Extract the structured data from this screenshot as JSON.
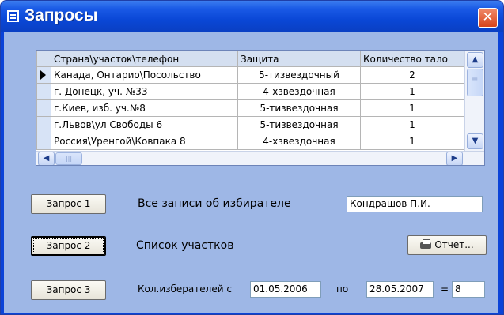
{
  "window": {
    "title": "Запросы",
    "close_glyph": "✕"
  },
  "grid": {
    "columns": [
      "Страна\\участок\\телефон",
      "Защита",
      "Количество тало"
    ],
    "rows": [
      {
        "c1": "Канада, Онтарио\\Посольство",
        "c2": "5-тизвездочный",
        "c3": "2"
      },
      {
        "c1": "г. Донецк, уч. №33",
        "c2": "4-хзвездочная",
        "c3": "1"
      },
      {
        "c1": "г.Киев, изб. уч.№8",
        "c2": "5-тизвездочная",
        "c3": "1"
      },
      {
        "c1": "г.Львов\\ул Свободы 6",
        "c2": "5-тизвездочная",
        "c3": "1"
      },
      {
        "c1": "Россия\\Уренгой\\Ковпака 8",
        "c2": "4-хзвездочная",
        "c3": "1"
      }
    ],
    "selected_row_index": 0,
    "scroll_up_glyph": "▲",
    "scroll_down_glyph": "▼",
    "scroll_left_glyph": "◀",
    "scroll_right_glyph": "▶",
    "hthumb_glyph": "|||"
  },
  "query1": {
    "button_label": "Запрос 1",
    "label": "Все записи об избирателе",
    "input_value": "Кондрашов П.И."
  },
  "query2": {
    "button_label": "Запрос 2",
    "label": "Список участков",
    "report_button_label": "Отчет..."
  },
  "query3": {
    "button_label": "Запрос 3",
    "label": "Кол.изберателей с",
    "date_from": "01.05.2006",
    "to_label": "по",
    "date_to": "28.05.2007",
    "equals_label": "=",
    "result": "8"
  },
  "icons": {
    "window": "form-icon",
    "close": "close-icon",
    "report": "printer-icon",
    "row_pointer": "row-pointer-icon"
  },
  "colors": {
    "titlebar": "#0a47d6",
    "client_bg": "#9eb7e6",
    "close_button": "#d8431a"
  }
}
